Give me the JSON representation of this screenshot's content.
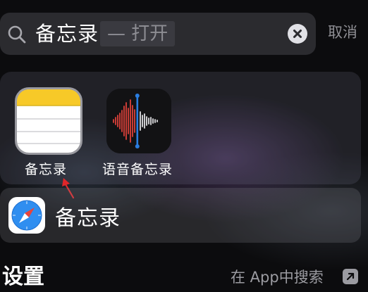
{
  "search": {
    "query": "备忘录",
    "suggestion": "— 打开",
    "cancel_label": "取消"
  },
  "app_suggestions": [
    {
      "name": "备忘录",
      "icon": "notes-app-icon"
    },
    {
      "name": "语音备忘录",
      "icon": "voice-memos-app-icon"
    }
  ],
  "top_hit": {
    "label": "备忘录",
    "icon": "safari-icon"
  },
  "section": {
    "title": "设置",
    "search_in_app_label": "在 App中搜索"
  },
  "colors": {
    "annotation_arrow": "#e0262a",
    "notes_yellow": "#f7c928",
    "voice_waveform_red": "#e8433b",
    "playhead_blue": "#2a7de0",
    "safari_blue": "#2f8ef0"
  }
}
